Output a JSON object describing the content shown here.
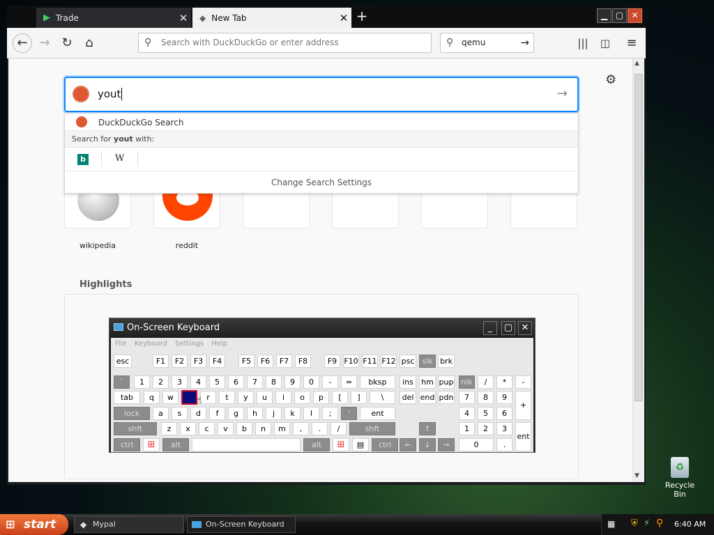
{
  "browser": {
    "tabs": [
      {
        "label": "Trade",
        "active": false
      },
      {
        "label": "New Tab",
        "active": true
      }
    ],
    "url_placeholder": "Search with DuckDuckGo or enter address",
    "search_bar_value": "qemu"
  },
  "newtab": {
    "search_value": "yout",
    "dropdown": {
      "engine_row": "DuckDuckGo Search",
      "search_for_prefix": "Search for ",
      "search_for_term": "yout",
      "search_for_suffix": " with:",
      "engines": [
        "bing-icon",
        "W"
      ],
      "change_settings": "Change Search Settings"
    },
    "tiles": [
      {
        "label": "wikipedia"
      },
      {
        "label": "reddit"
      },
      {
        "label": ""
      },
      {
        "label": ""
      },
      {
        "label": ""
      },
      {
        "label": ""
      }
    ],
    "highlights_title": "Highlights"
  },
  "osk": {
    "title": "On-Screen Keyboard",
    "menu": [
      "File",
      "Keyboard",
      "Settings",
      "Help"
    ],
    "rows": [
      [
        "esc",
        "F1",
        "F2",
        "F3",
        "F4",
        "F5",
        "F6",
        "F7",
        "F8",
        "F9",
        "F10",
        "F11",
        "F12",
        "psc",
        "slk",
        "brk"
      ],
      [
        "`",
        "1",
        "2",
        "3",
        "4",
        "5",
        "6",
        "7",
        "8",
        "9",
        "0",
        "-",
        "=",
        "bksp",
        "ins",
        "hm",
        "pup",
        "nlk",
        "/",
        "*",
        "-"
      ],
      [
        "tab",
        "q",
        "w",
        "e",
        "r",
        "t",
        "y",
        "u",
        "i",
        "o",
        "p",
        "[",
        "]",
        "\\",
        "del",
        "end",
        "pdn",
        "7",
        "8",
        "9",
        "+"
      ],
      [
        "lock",
        "a",
        "s",
        "d",
        "f",
        "g",
        "h",
        "j",
        "k",
        "l",
        ";",
        "'",
        "ent",
        "4",
        "5",
        "6"
      ],
      [
        "shft",
        "z",
        "x",
        "c",
        "v",
        "b",
        "n",
        "m",
        ",",
        ".",
        "/",
        "shft",
        "↑",
        "1",
        "2",
        "3",
        "ent"
      ],
      [
        "ctrl",
        "alt",
        "alt",
        "ctrl",
        "←",
        "↓",
        "→",
        "0",
        "."
      ]
    ]
  },
  "desktop": {
    "recycle_bin": "Recycle Bin"
  },
  "taskbar": {
    "start": "start",
    "tasks": [
      "Mypal",
      "On-Screen Keyboard"
    ],
    "clock": "6:40 AM"
  }
}
